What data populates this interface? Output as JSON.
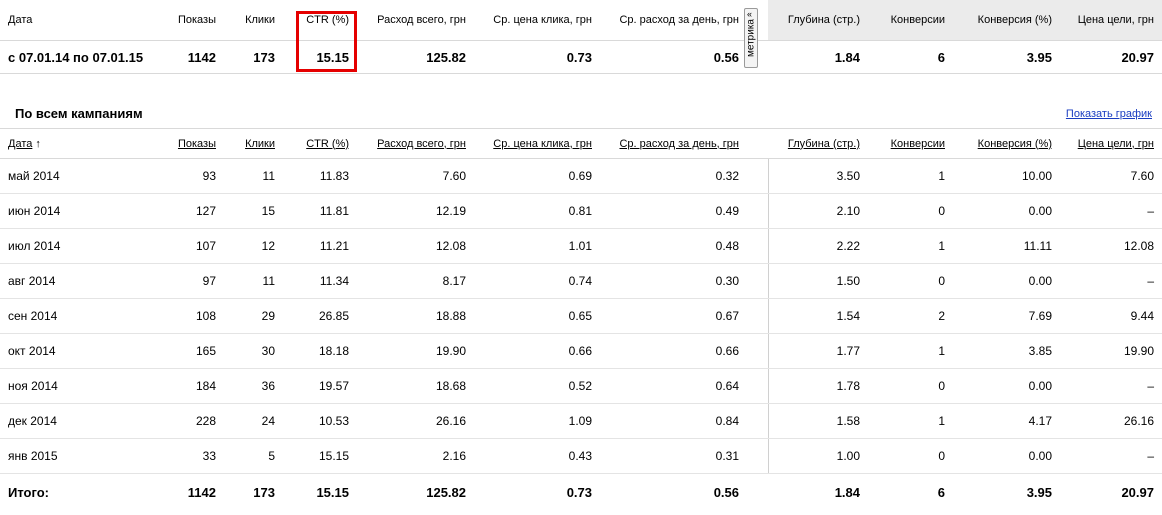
{
  "summary": {
    "headers": [
      "Дата",
      "Показы",
      "Клики",
      "CTR (%)",
      "Расход всего, грн",
      "Ср. цена клика, грн",
      "Ср. расход за день, грн",
      "Глубина (стр.)",
      "Конверсии",
      "Конверсия (%)",
      "Цена цели, грн"
    ],
    "values": [
      "с 07.01.14 по 07.01.15",
      "1142",
      "173",
      "15.15",
      "125.82",
      "0.73",
      "0.56",
      "1.84",
      "6",
      "3.95",
      "20.97"
    ],
    "metrika_label": "метрика",
    "metrika_arrow": "«"
  },
  "campaigns": {
    "title": "По всем кампаниям",
    "show_graph": "Показать график",
    "headers": [
      "Дата",
      "Показы",
      "Клики",
      "CTR (%)",
      "Расход всего, грн",
      "Ср. цена клика, грн",
      "Ср. расход за день, грн",
      "Глубина (стр.)",
      "Конверсии",
      "Конверсия (%)",
      "Цена цели, грн"
    ],
    "sort_arrow": "↑",
    "rows": [
      [
        "май 2014",
        "93",
        "11",
        "11.83",
        "7.60",
        "0.69",
        "0.32",
        "3.50",
        "1",
        "10.00",
        "7.60"
      ],
      [
        "июн 2014",
        "127",
        "15",
        "11.81",
        "12.19",
        "0.81",
        "0.49",
        "2.10",
        "0",
        "0.00",
        "–"
      ],
      [
        "июл 2014",
        "107",
        "12",
        "11.21",
        "12.08",
        "1.01",
        "0.48",
        "2.22",
        "1",
        "11.11",
        "12.08"
      ],
      [
        "авг 2014",
        "97",
        "11",
        "11.34",
        "8.17",
        "0.74",
        "0.30",
        "1.50",
        "0",
        "0.00",
        "–"
      ],
      [
        "сен 2014",
        "108",
        "29",
        "26.85",
        "18.88",
        "0.65",
        "0.67",
        "1.54",
        "2",
        "7.69",
        "9.44"
      ],
      [
        "окт 2014",
        "165",
        "30",
        "18.18",
        "19.90",
        "0.66",
        "0.66",
        "1.77",
        "1",
        "3.85",
        "19.90"
      ],
      [
        "ноя 2014",
        "184",
        "36",
        "19.57",
        "18.68",
        "0.52",
        "0.64",
        "1.78",
        "0",
        "0.00",
        "–"
      ],
      [
        "дек 2014",
        "228",
        "24",
        "10.53",
        "26.16",
        "1.09",
        "0.84",
        "1.58",
        "1",
        "4.17",
        "26.16"
      ],
      [
        "янв 2015",
        "33",
        "5",
        "15.15",
        "2.16",
        "0.43",
        "0.31",
        "1.00",
        "0",
        "0.00",
        "–"
      ]
    ],
    "total": [
      "Итого:",
      "1142",
      "173",
      "15.15",
      "125.82",
      "0.73",
      "0.56",
      "1.84",
      "6",
      "3.95",
      "20.97"
    ]
  }
}
